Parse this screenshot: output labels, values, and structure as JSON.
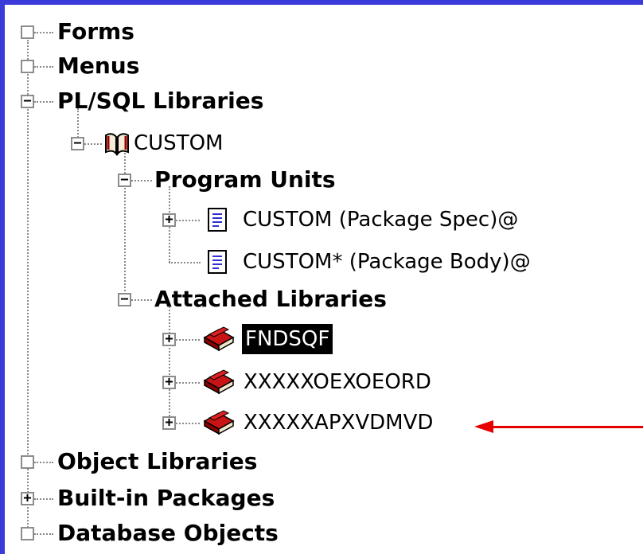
{
  "tree": {
    "forms": "Forms",
    "menus": "Menus",
    "plsql_libraries": "PL/SQL Libraries",
    "custom": "CUSTOM",
    "program_units": "Program Units",
    "custom_spec": "CUSTOM (Package Spec)@",
    "custom_body": "CUSTOM* (Package Body)@",
    "attached_libraries": "Attached Libraries",
    "lib_fndsqf": "FNDSQF",
    "lib_oexoeord": "XXXXXOEXOEORD",
    "lib_apxvdmvd": "XXXXXAPXVDMVD",
    "object_libraries": "Object Libraries",
    "builtin_packages": "Built-in Packages",
    "database_objects": "Database Objects"
  },
  "expander_symbols": {
    "expanded": "−",
    "collapsed": "+"
  },
  "icons": {
    "custom_library": "open-book-icon",
    "package_spec": "document-icon",
    "package_body": "document-icon",
    "attached_library": "red-books-icon"
  },
  "colors": {
    "background": "#3b3bd9",
    "panel": "#ffffff",
    "selection": "#000000",
    "arrow": "#e60000"
  }
}
